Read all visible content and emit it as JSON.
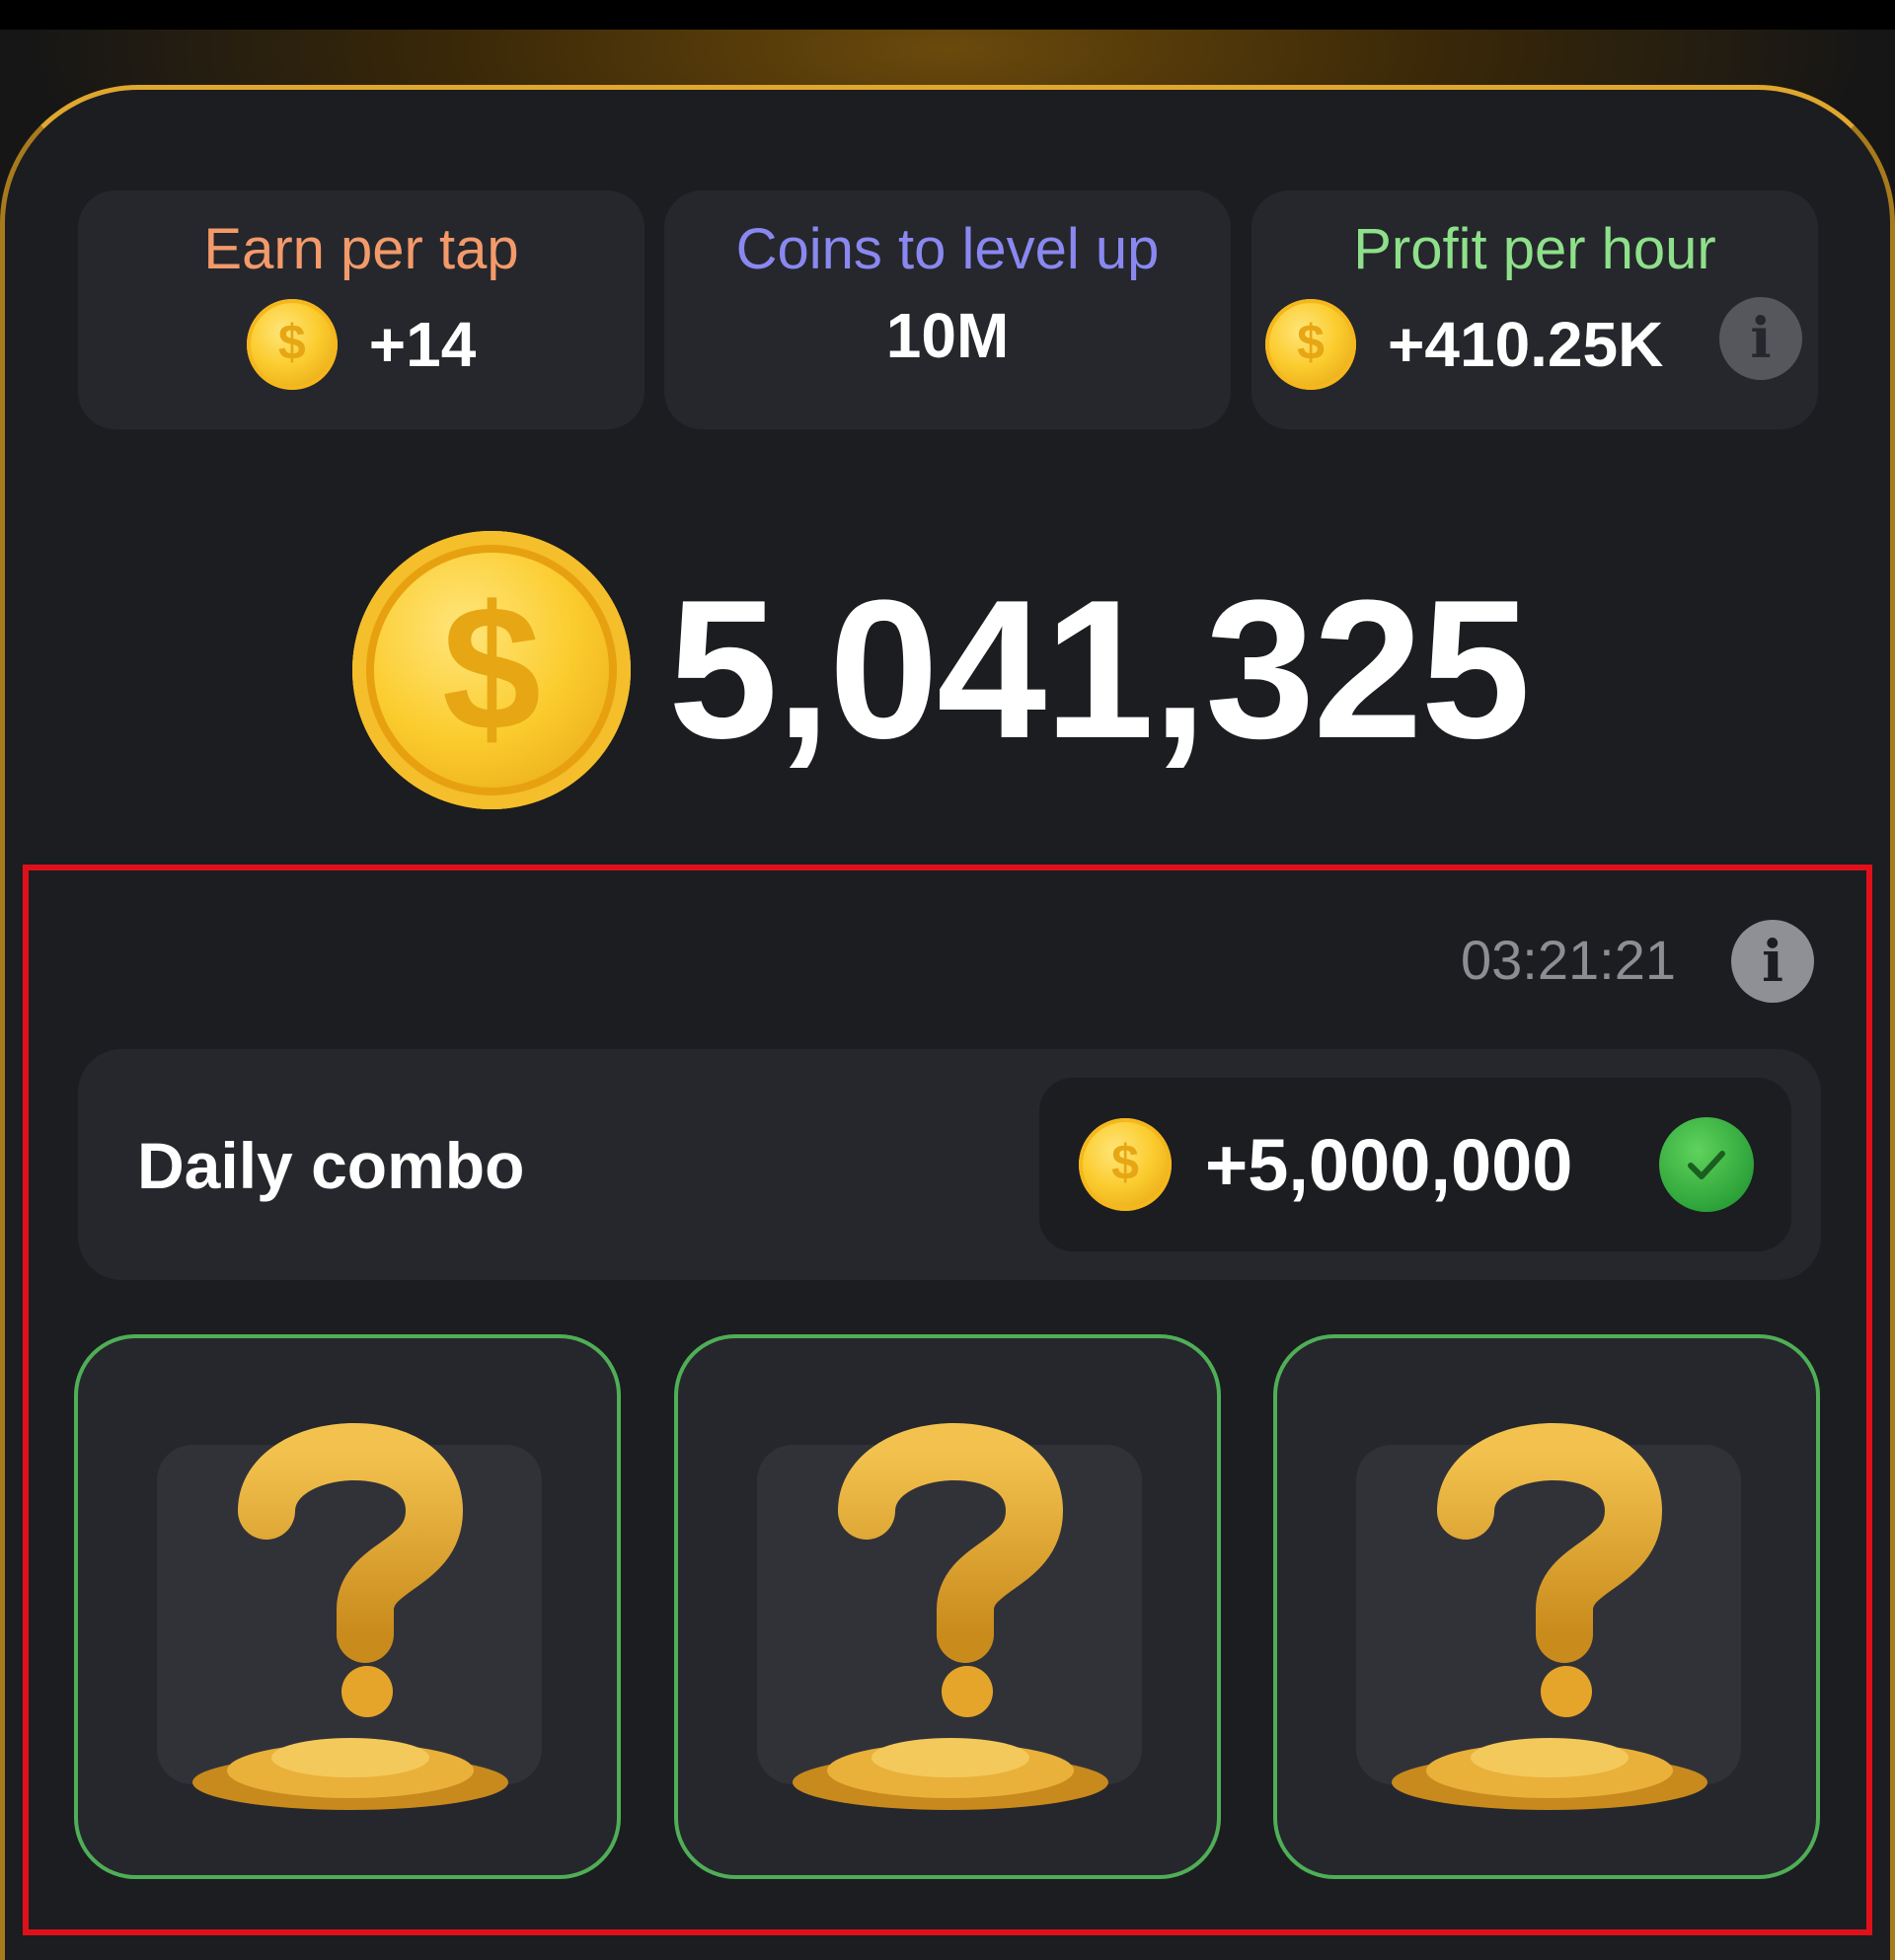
{
  "colors": {
    "panel": "#1b1d21",
    "card": "#25272c",
    "gold_border": "#e0a72e",
    "earn_label": "#f39a6a",
    "level_label": "#8a88f0",
    "profit_label": "#8ee08a",
    "highlight_border": "#e0101a",
    "card_border": "#4fae56"
  },
  "stats": [
    {
      "label": "Earn per tap",
      "value": "+14",
      "icon": "coin-icon"
    },
    {
      "label": "Coins to level up",
      "value": "10M"
    },
    {
      "label": "Profit per hour",
      "value": "+410.25K",
      "icon": "coin-icon",
      "info_icon": "info-icon"
    }
  ],
  "balance": {
    "amount": "5,041,325",
    "icon": "big-coin-icon"
  },
  "coin_symbol": "$",
  "info_glyph": "i",
  "timer": {
    "value": "03:21:21"
  },
  "daily_combo": {
    "title": "Daily combo",
    "reward": "+5,000,000",
    "status_icon": "check-icon",
    "cards": [
      {
        "icon": "question-coins-icon"
      },
      {
        "icon": "question-coins-icon"
      },
      {
        "icon": "question-coins-icon"
      }
    ]
  }
}
